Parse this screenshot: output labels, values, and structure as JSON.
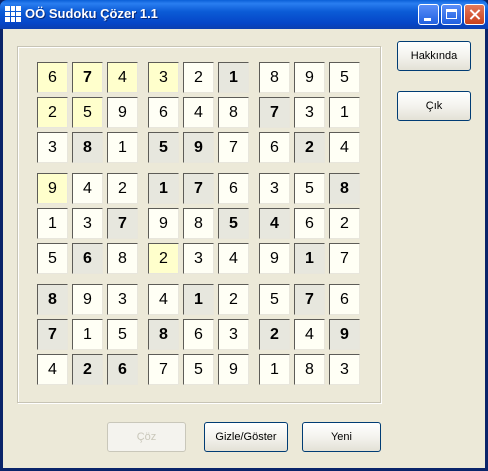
{
  "window": {
    "title": "OÖ Sudoku Çözer 1.1"
  },
  "buttons": {
    "about": "Hakkında",
    "exit": "Çık",
    "solve": "Çöz",
    "hide_show": "Gizle/Göster",
    "new": "Yeni"
  },
  "colors": {
    "given": "#ffffcc",
    "bold": "#e7e7de",
    "solved": "#fffff5"
  },
  "board": {
    "values": [
      [
        6,
        7,
        4,
        3,
        2,
        1,
        8,
        9,
        5
      ],
      [
        2,
        5,
        9,
        6,
        4,
        8,
        7,
        3,
        1
      ],
      [
        3,
        8,
        1,
        5,
        9,
        7,
        6,
        2,
        4
      ],
      [
        9,
        4,
        2,
        1,
        7,
        6,
        3,
        5,
        8
      ],
      [
        1,
        3,
        7,
        9,
        8,
        5,
        4,
        6,
        2
      ],
      [
        5,
        6,
        8,
        2,
        3,
        4,
        9,
        1,
        7
      ],
      [
        8,
        9,
        3,
        4,
        1,
        2,
        5,
        7,
        6
      ],
      [
        7,
        1,
        5,
        8,
        6,
        3,
        2,
        4,
        9
      ],
      [
        4,
        2,
        6,
        7,
        5,
        9,
        1,
        8,
        3
      ]
    ],
    "styles": [
      [
        "y",
        "yb",
        "y",
        "y",
        "n",
        "b",
        "n",
        "n",
        "n"
      ],
      [
        "y",
        "y",
        "n",
        "n",
        "n",
        "n",
        "b",
        "n",
        "n"
      ],
      [
        "n",
        "b",
        "n",
        "b",
        "b",
        "n",
        "n",
        "b",
        "n"
      ],
      [
        "y",
        "n",
        "n",
        "b",
        "b",
        "n",
        "n",
        "n",
        "b"
      ],
      [
        "n",
        "n",
        "b",
        "n",
        "n",
        "b",
        "b",
        "n",
        "n"
      ],
      [
        "n",
        "b",
        "n",
        "y",
        "n",
        "n",
        "n",
        "b",
        "n"
      ],
      [
        "b",
        "n",
        "n",
        "n",
        "b",
        "n",
        "n",
        "b",
        "n"
      ],
      [
        "b",
        "n",
        "n",
        "b",
        "n",
        "n",
        "b",
        "n",
        "b"
      ],
      [
        "n",
        "b",
        "b",
        "n",
        "n",
        "n",
        "n",
        "n",
        "n"
      ]
    ]
  }
}
